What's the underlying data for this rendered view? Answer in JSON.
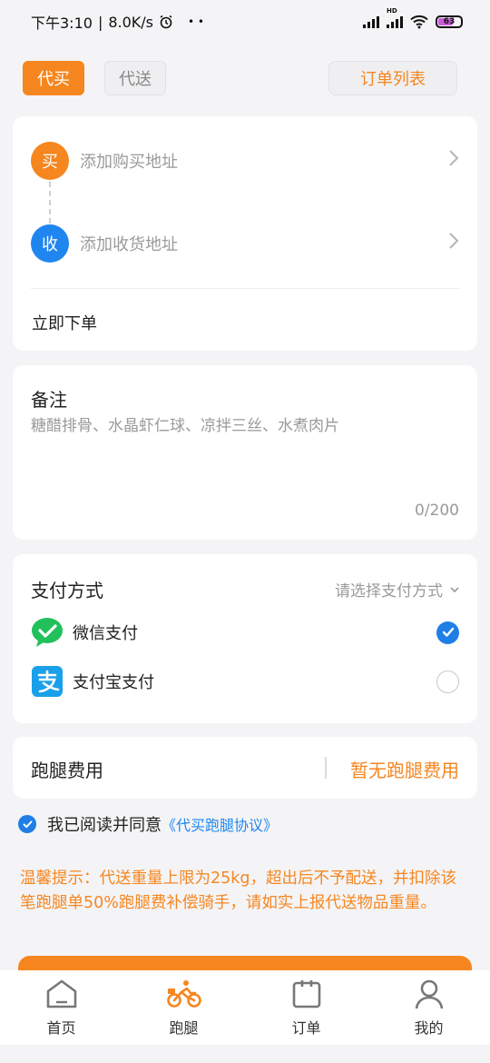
{
  "status_bar": {
    "time": "下午3:10",
    "net_speed": "8.0K/s",
    "dots": "• •",
    "battery": "63",
    "hd_label": "HD"
  },
  "tabs": {
    "buy": "代买",
    "deliver": "代送",
    "order_list": "订单列表"
  },
  "address": {
    "buy_badge": "买",
    "buy_placeholder": "添加购买地址",
    "receive_badge": "收",
    "receive_placeholder": "添加收货地址",
    "order_now": "立即下单"
  },
  "note": {
    "title": "备注",
    "placeholder": "糖醋排骨、水晶虾仁球、凉拌三丝、水煮肉片",
    "count": "0/200"
  },
  "payment": {
    "title": "支付方式",
    "select_placeholder": "请选择支付方式",
    "options": [
      {
        "label": "微信支付",
        "icon": "wechat-pay-icon",
        "selected": true
      },
      {
        "label": "支付宝支付",
        "icon": "alipay-icon",
        "selected": false
      }
    ]
  },
  "fee": {
    "title": "跑腿费用",
    "value": "暂无跑腿费用"
  },
  "agreement": {
    "text": "我已阅读并同意",
    "link": "《代买跑腿协议》",
    "checked": true
  },
  "tip": "温馨提示：代送重量上限为25kg，超出后不予配送，并扣除该笔跑腿单50%跑腿费补偿骑手，请如实上报代送物品重量。",
  "nav": [
    {
      "label": "首页",
      "icon": "home-icon"
    },
    {
      "label": "跑腿",
      "icon": "bike-icon"
    },
    {
      "label": "订单",
      "icon": "order-icon"
    },
    {
      "label": "我的",
      "icon": "profile-icon"
    }
  ],
  "colors": {
    "accent": "#f6861f",
    "blue": "#1f86f0",
    "wechat": "#22c05a",
    "alipay": "#1aa0ea"
  }
}
